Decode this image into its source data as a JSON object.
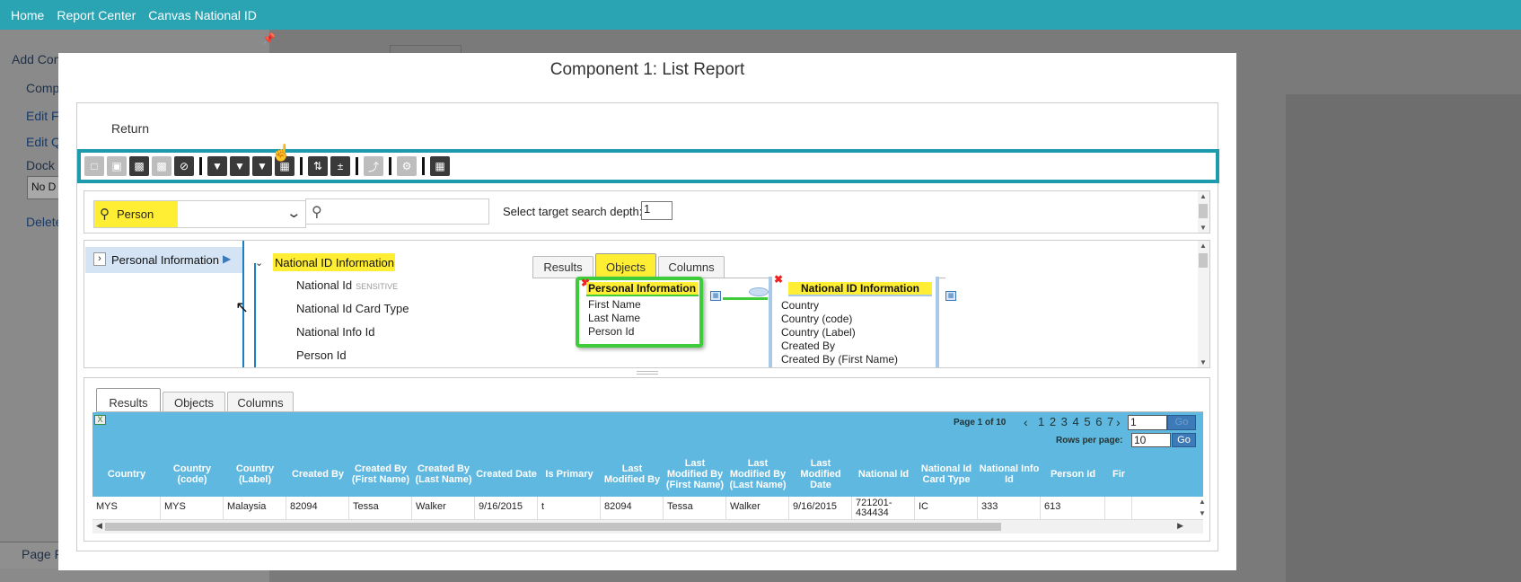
{
  "topnav": {
    "items": [
      "Home",
      "Report Center",
      "Canvas National ID"
    ]
  },
  "background": {
    "add_label": "Add Con",
    "comp_label": "Comp",
    "edit_f": "Edit F",
    "edit_q": "Edit Q",
    "dock_label": "Dock I",
    "dock_value": "No D",
    "delete_label": "Delete",
    "page_label": "Page F"
  },
  "modal": {
    "title": "Component 1: List Report",
    "return_label": "Return"
  },
  "toolbar": {
    "buttons": [
      "new-icon",
      "open-icon",
      "save-icon",
      "save-as-icon",
      "cancel-icon",
      "filter-icon",
      "filter-edit-icon",
      "filter-clear-icon",
      "filter-advanced-icon",
      "sort-icon",
      "calculation-icon",
      "export-icon",
      "settings-icon",
      "chart-icon"
    ]
  },
  "search": {
    "object_value": "Person",
    "search_placeholder": "",
    "depth_label": "Select target search depth:",
    "depth_value": "1"
  },
  "tree": {
    "parent": "Personal Information",
    "child": "National ID Information",
    "fields": [
      "National Id",
      "National Id Card Type",
      "National Info Id",
      "Person Id"
    ],
    "sensitive_tag": "SENSITIVE"
  },
  "mid_tabs": [
    "Results",
    "Objects",
    "Columns"
  ],
  "diagram": {
    "box1": {
      "title": "Personal Information",
      "fields": [
        "First Name",
        "Last Name",
        "Person Id"
      ]
    },
    "box2": {
      "title": "National ID Information",
      "fields": [
        "Country",
        "Country (code)",
        "Country (Label)",
        "Created By",
        "Created By (First Name)"
      ]
    }
  },
  "bottom_tabs": [
    "Results",
    "Objects",
    "Columns"
  ],
  "pager": {
    "page_text": "Page 1 of 10",
    "pages": "1 2 3 4 5 6 7",
    "page_input": "1",
    "go_label": "Go",
    "rows_label": "Rows per page:",
    "rows_value": "10",
    "rows_go": "Go"
  },
  "grid": {
    "columns": [
      "Country",
      "Country (code)",
      "Country (Label)",
      "Created By",
      "Created By (First Name)",
      "Created By (Last Name)",
      "Created Date",
      "Is Primary",
      "Last Modified By",
      "Last Modified By (First Name)",
      "Last Modified By (Last Name)",
      "Last Modified Date",
      "National Id",
      "National Id Card Type",
      "National Info Id",
      "Person Id",
      "Fir"
    ],
    "rows": [
      [
        "MYS",
        "MYS",
        "Malaysia",
        "82094",
        "Tessa",
        "Walker",
        "9/16/2015",
        "t",
        "82094",
        "Tessa",
        "Walker",
        "9/16/2015",
        "721201-434434",
        "IC",
        "333",
        "613",
        ""
      ]
    ]
  }
}
